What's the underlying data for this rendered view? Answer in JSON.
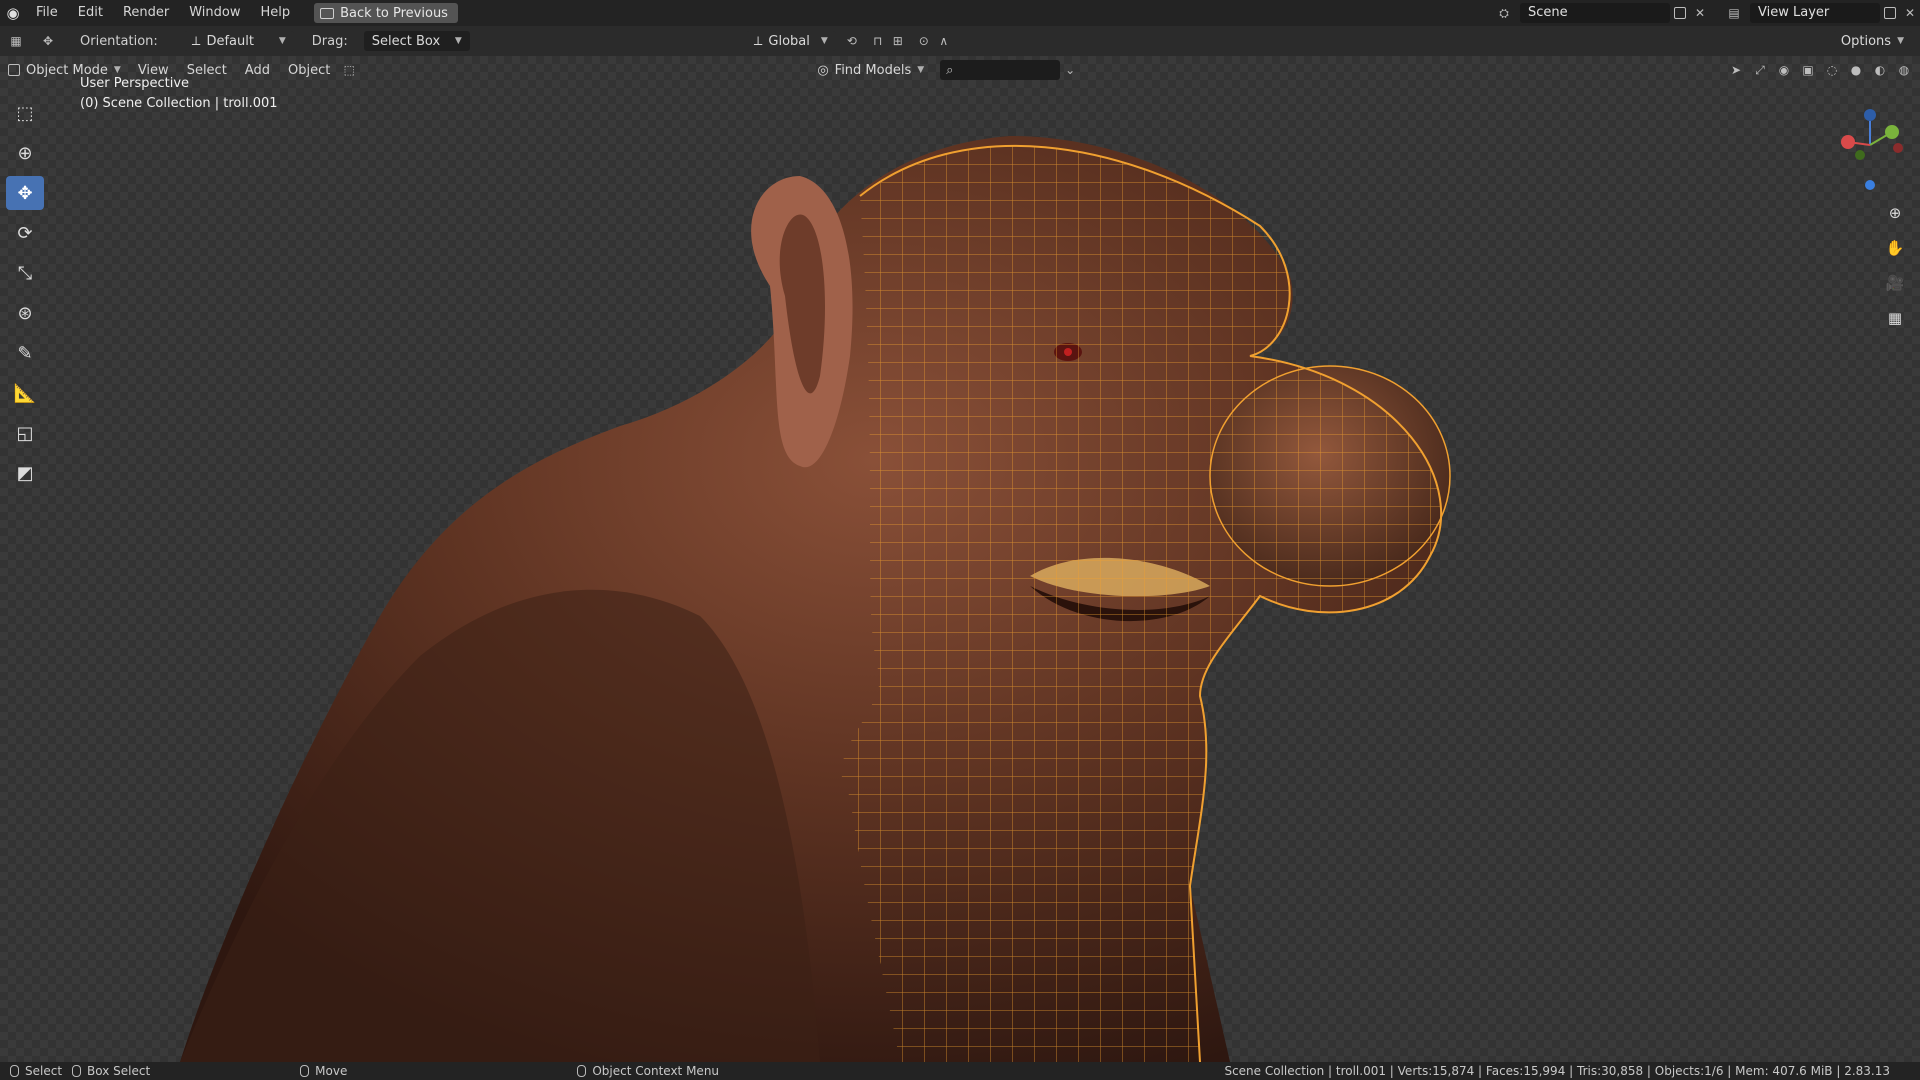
{
  "menu": {
    "logo_icon": "blender-logo-icon",
    "items": [
      "File",
      "Edit",
      "Render",
      "Window",
      "Help"
    ],
    "back_button": "Back to Previous",
    "scene": "Scene",
    "view_layer": "View Layer"
  },
  "toolheader": {
    "orientation_label": "Orientation:",
    "orientation_value": "Default",
    "drag_label": "Drag:",
    "drag_value": "Select Box",
    "transform_orientation": "Global",
    "options": "Options"
  },
  "vpheader": {
    "mode": "Object Mode",
    "items": [
      "View",
      "Select",
      "Add",
      "Object"
    ],
    "find_models": "Find Models",
    "search_placeholder": ""
  },
  "viewport": {
    "perspective": "User Perspective",
    "collection_info": "(0) Scene Collection | troll.001",
    "wire_color": "#f0a030",
    "accent": "#4772b3"
  },
  "toolbar": {
    "tools": [
      "select-box",
      "cursor",
      "move",
      "rotate",
      "scale",
      "transform",
      "annotate",
      "measure",
      "add-cube",
      "add-primitive"
    ],
    "active": "move"
  },
  "status": {
    "select": "Select",
    "box_select": "Box Select",
    "move": "Move",
    "context_menu": "Object Context Menu",
    "stats": "Scene Collection | troll.001 | Verts:15,874 | Faces:15,994 | Tris:30,858 | Objects:1/6 | Mem: 407.6 MiB | 2.83.13"
  }
}
